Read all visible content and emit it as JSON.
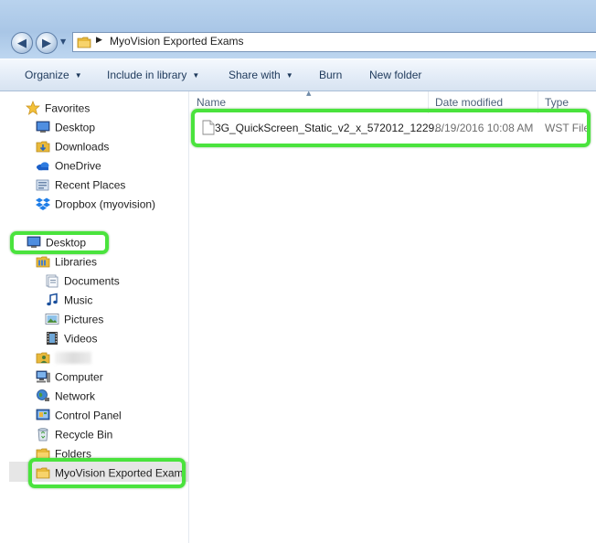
{
  "window": {
    "address_path": "MyoVision Exported Exams",
    "back_icon": "back-arrow-icon",
    "forward_icon": "forward-arrow-icon"
  },
  "toolbar": {
    "organize": "Organize",
    "include_in_library": "Include in library",
    "share_with": "Share with",
    "burn": "Burn",
    "new_folder": "New folder"
  },
  "nav": {
    "favorites": {
      "label": "Favorites",
      "items": [
        {
          "label": "Desktop",
          "icon": "desktop-icon"
        },
        {
          "label": "Downloads",
          "icon": "downloads-folder-icon"
        },
        {
          "label": "OneDrive",
          "icon": "onedrive-cloud-icon"
        },
        {
          "label": "Recent Places",
          "icon": "recent-places-icon"
        },
        {
          "label": "Dropbox (myovision)",
          "icon": "dropbox-icon"
        }
      ]
    },
    "desktop": "Desktop",
    "libraries": {
      "label": "Libraries",
      "items": [
        {
          "label": "Documents",
          "icon": "documents-icon"
        },
        {
          "label": "Music",
          "icon": "music-note-icon"
        },
        {
          "label": "Pictures",
          "icon": "pictures-icon"
        },
        {
          "label": "Videos",
          "icon": "videos-film-icon"
        }
      ]
    },
    "user_folder": "",
    "computer": "Computer",
    "network": "Network",
    "control_panel": "Control Panel",
    "recycle_bin": "Recycle Bin",
    "folders": "Folders",
    "current_folder": "MyoVision Exported Exam"
  },
  "columns": {
    "name": "Name",
    "date_modified": "Date modified",
    "type": "Type"
  },
  "files": [
    {
      "name": "3G_QuickScreen_Static_v2_x_572012_1229...",
      "date_modified": "8/19/2016 10:08 AM",
      "type": "WST File",
      "icon": "generic-file-icon"
    }
  ],
  "colors": {
    "highlight": "#4ae33d",
    "command_text": "#1e395b",
    "header_text": "#4c607a",
    "meta_text": "#6d6d6d"
  }
}
